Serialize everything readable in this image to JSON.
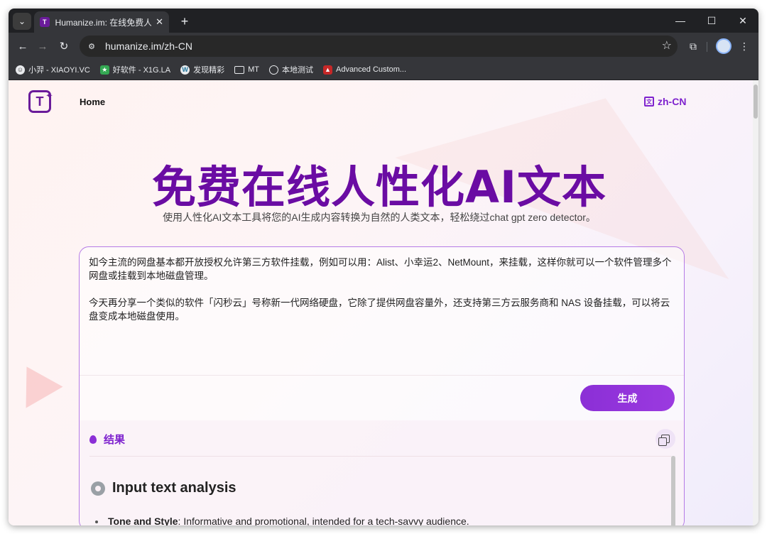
{
  "browser": {
    "tab_title": "Humanize.im: 在线免费人性化",
    "url": "humanize.im/zh-CN",
    "bookmarks": [
      {
        "label": "小羿 - XIAOYI.VC"
      },
      {
        "label": "好软件 - X1G.LA"
      },
      {
        "label": "发现精彩"
      },
      {
        "label": "MT"
      },
      {
        "label": "本地测试"
      },
      {
        "label": "Advanced Custom..."
      }
    ]
  },
  "header": {
    "nav_home": "Home",
    "language": "zh-CN"
  },
  "hero": {
    "title": "免费在线人性化AI文本",
    "subtitle": "使用人性化AI文本工具将您的AI生成内容转换为自然的人类文本，轻松绕过chat gpt zero detector。"
  },
  "editor": {
    "paragraph1": "如今主流的网盘基本都开放授权允许第三方软件挂载，例如可以用：Alist、小幸运2、NetMount，来挂载，这样你就可以一个软件管理多个网盘或挂载到本地磁盘管理。",
    "paragraph2": "今天再分享一个类似的软件「闪秒云」号称新一代网络硬盘，它除了提供网盘容量外，还支持第三方云服务商和 NAS 设备挂载，可以将云盘变成本地磁盘使用。",
    "generate_label": "生成"
  },
  "result": {
    "heading": "结果",
    "analysis_title": "Input text analysis",
    "tone_label": "Tone and Style",
    "tone_value": ": Informative and promotional, intended for a tech-savvy audience."
  },
  "colors": {
    "brand": "#6a0ca3",
    "accent": "#8b2fd6"
  }
}
